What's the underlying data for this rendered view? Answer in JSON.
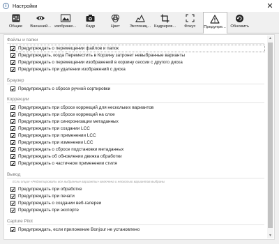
{
  "window": {
    "title": "Настройки",
    "app_icon": "info-icon",
    "close_glyph": "✕"
  },
  "tabs": [
    {
      "label": "Общие",
      "icon": "sliders-icon",
      "active": false
    },
    {
      "label": "Внешний...",
      "icon": "eye-icon",
      "active": false
    },
    {
      "label": "изображе...",
      "icon": "image-icon",
      "active": false
    },
    {
      "label": "Кадр",
      "icon": "camera-icon",
      "active": false
    },
    {
      "label": "Цвет",
      "icon": "color-icon",
      "active": false
    },
    {
      "label": "Экспозиц...",
      "icon": "exposure-icon",
      "active": false
    },
    {
      "label": "Кадриров...",
      "icon": "crop-icon",
      "active": false
    },
    {
      "label": "Фокус",
      "icon": "focus-icon",
      "active": false
    },
    {
      "label": "Предупре...",
      "icon": "warning-icon",
      "active": true
    },
    {
      "label": "Обновить",
      "icon": "update-icon",
      "active": false
    }
  ],
  "sections": {
    "files": {
      "title": "Файлы и папки",
      "items": [
        {
          "label": "Предупреждать о перемещении файлов и папок",
          "checked": true
        },
        {
          "label": "Предупреждать, когда Переместить в Корзину затронет невыбранные варианты",
          "checked": true
        },
        {
          "label": "Предупреждать о перемещении изображений в корзину сессии с другого диска",
          "checked": true
        },
        {
          "label": "Предупреждать при удалении изображений с диска",
          "checked": true
        }
      ]
    },
    "browser": {
      "title": "Браузер",
      "items": [
        {
          "label": "Предупреждать о сбросе ручной сортировки",
          "checked": true
        }
      ]
    },
    "corrections": {
      "title": "Коррекции",
      "items": [
        {
          "label": "Предупреждать при сбросе коррекций для нескольких вариантов",
          "checked": true
        },
        {
          "label": "Предупреждать при сбросе коррекций на слое",
          "checked": true
        },
        {
          "label": "Предупреждать при синхронизации метаданных",
          "checked": true
        },
        {
          "label": "Предупреждать при создании LCC",
          "checked": true
        },
        {
          "label": "Предупреждать при применении LCC",
          "checked": true
        },
        {
          "label": "Предупреждать при изменении LCC",
          "checked": true
        },
        {
          "label": "Предупреждать о сбросе подстановки метаданных",
          "checked": true
        },
        {
          "label": "Предупреждать об обновлении движка обработки",
          "checked": true
        },
        {
          "label": "Предупреждать о частичном применении стиля",
          "checked": true
        }
      ]
    },
    "output": {
      "title": "Вывод",
      "note": "Если опция «Редактировать все выбранные варианты» включена и несколько вариантов выбраны",
      "items": [
        {
          "label": "Предупреждать при обработке",
          "checked": true
        },
        {
          "label": "Предупреждать при печати",
          "checked": true
        },
        {
          "label": "Предупреждать о создании веб-галереи",
          "checked": true
        },
        {
          "label": "Предупреждать при экспорте",
          "checked": true
        }
      ]
    },
    "pilot": {
      "title": "Capture Pilot",
      "items": [
        {
          "label": "Предупреждать, если приложение Bonjour не установлено",
          "checked": true
        }
      ]
    }
  },
  "scrollbar": {
    "up_glyph": "▲",
    "down_glyph": "▼"
  }
}
